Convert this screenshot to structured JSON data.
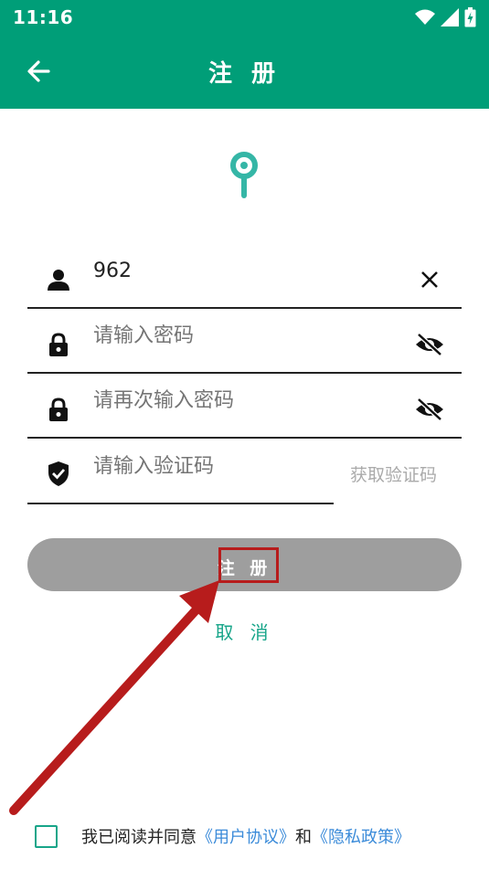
{
  "status_bar": {
    "time": "11:16",
    "icons": [
      "wifi-icon",
      "signal-icon",
      "battery-charging-icon"
    ]
  },
  "app_bar": {
    "back_icon": "arrow-left-icon",
    "title": "注 册"
  },
  "colors": {
    "primary": "#009e78",
    "accent_text": "#17a589",
    "disabled_button": "#9e9e9e",
    "link": "#3b8bd9",
    "annotation_red": "#b71c1c"
  },
  "form": {
    "username": {
      "value": "962",
      "icon": "person-icon",
      "trailing_icon": "clear-icon"
    },
    "password": {
      "placeholder": "请输入密码",
      "icon": "lock-icon",
      "trailing_icon": "eye-off-icon"
    },
    "confirm_password": {
      "placeholder": "请再次输入密码",
      "icon": "lock-icon",
      "trailing_icon": "eye-off-icon"
    },
    "verification_code": {
      "placeholder": "请输入验证码",
      "icon": "shield-check-icon",
      "get_code_label": "获取验证码"
    }
  },
  "register_button": {
    "label": "注 册"
  },
  "cancel_link": {
    "label": "取 消"
  },
  "agreement": {
    "prefix": "我已阅读并同意",
    "user_agreement": "《用户协议》",
    "conjunction": "和",
    "privacy_policy": "《隐私政策》"
  }
}
